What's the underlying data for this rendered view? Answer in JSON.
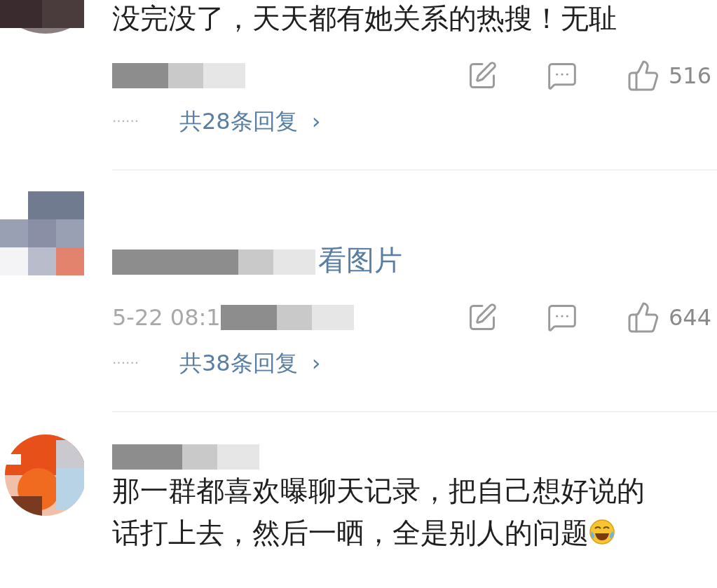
{
  "comments": [
    {
      "avatar": {
        "kind": "picture"
      },
      "body": [
        {
          "kind": "text",
          "text": "没完没了，天天都有她关系的热搜！无耻"
        }
      ],
      "meta": {
        "redacted": true
      },
      "likes": "516",
      "replies": {
        "dots": "······",
        "label": "共28条回复",
        "arrow": "›"
      }
    },
    {
      "avatar": {
        "kind": "picture"
      },
      "body": [
        {
          "kind": "redacted"
        },
        {
          "kind": "link",
          "text": "看图片"
        }
      ],
      "meta": {
        "timestamp": "5-22 08:1",
        "redacted": true
      },
      "likes": "644",
      "replies": {
        "dots": "······",
        "label": "共38条回复",
        "arrow": "›"
      }
    },
    {
      "avatar": {
        "kind": "picture"
      },
      "username_redacted": true,
      "body": [
        {
          "kind": "text",
          "text": "那一群都喜欢曝聊天记录，把自己想好说的"
        },
        {
          "kind": "text",
          "text": "话打上去，然后一晒，全是别人的问题"
        },
        {
          "kind": "emoji"
        }
      ]
    }
  ]
}
